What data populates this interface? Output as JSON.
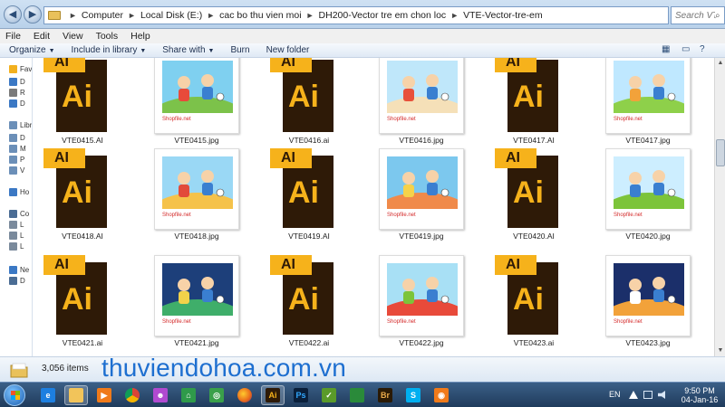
{
  "address": {
    "crumbs": [
      "Computer",
      "Local Disk (E:)",
      "cac bo thu vien moi",
      "DH200-Vector tre em chon loc",
      "VTE-Vector-tre-em"
    ]
  },
  "search": {
    "placeholder": "Search VTE..."
  },
  "menu": [
    "File",
    "Edit",
    "View",
    "Tools",
    "Help"
  ],
  "commands": {
    "organize": "Organize",
    "include": "Include in library",
    "share": "Share with",
    "burn": "Burn",
    "new_folder": "New folder"
  },
  "nav": [
    {
      "label": "Fav",
      "icon": "star-icon",
      "color": "#f2b01e"
    },
    {
      "label": "D",
      "icon": "desktop-icon",
      "color": "#3b78c4"
    },
    {
      "label": "R",
      "icon": "recent-icon",
      "color": "#7a7a7a"
    },
    {
      "label": "D",
      "icon": "downloads-icon",
      "color": "#3b78c4"
    },
    {
      "label": "Libr",
      "icon": "library-icon",
      "color": "#6b8fb8"
    },
    {
      "label": "D",
      "icon": "documents-icon",
      "color": "#6b8fb8"
    },
    {
      "label": "M",
      "icon": "music-icon",
      "color": "#6b8fb8"
    },
    {
      "label": "P",
      "icon": "pictures-icon",
      "color": "#6b8fb8"
    },
    {
      "label": "V",
      "icon": "videos-icon",
      "color": "#6b8fb8"
    },
    {
      "label": "Ho",
      "icon": "homegroup-icon",
      "color": "#3b78c4"
    },
    {
      "label": "Co",
      "icon": "computer-icon",
      "color": "#4a6c94"
    },
    {
      "label": "L",
      "icon": "drive-icon",
      "color": "#7a8a9c"
    },
    {
      "label": "L",
      "icon": "drive-icon",
      "color": "#7a8a9c"
    },
    {
      "label": "L",
      "icon": "drive-icon",
      "color": "#7a8a9c"
    },
    {
      "label": "Ne",
      "icon": "network-icon",
      "color": "#3b78c4"
    },
    {
      "label": "D",
      "icon": "network-pc-icon",
      "color": "#4a6c94"
    }
  ],
  "files": [
    {
      "name": "VTE0415.AI",
      "type": "ai"
    },
    {
      "name": "VTE0415.jpg",
      "type": "jpg",
      "palette": [
        "#7fd0f0",
        "#7cc24a",
        "#e84a3a"
      ]
    },
    {
      "name": "VTE0416.ai",
      "type": "ai"
    },
    {
      "name": "VTE0416.jpg",
      "type": "jpg",
      "palette": [
        "#bfe7fa",
        "#f5e0b8",
        "#e8503a"
      ]
    },
    {
      "name": "VTE0417.AI",
      "type": "ai"
    },
    {
      "name": "VTE0417.jpg",
      "type": "jpg",
      "palette": [
        "#bfe8ff",
        "#8ed04a",
        "#f2a23a"
      ]
    },
    {
      "name": "VTE0418.AI",
      "type": "ai"
    },
    {
      "name": "VTE0418.jpg",
      "type": "jpg",
      "palette": [
        "#9ad8f5",
        "#f5c24a",
        "#e24a3a"
      ]
    },
    {
      "name": "VTE0419.AI",
      "type": "ai"
    },
    {
      "name": "VTE0419.jpg",
      "type": "jpg",
      "palette": [
        "#7cc8ee",
        "#f08a4a",
        "#f5d24a"
      ]
    },
    {
      "name": "VTE0420.AI",
      "type": "ai"
    },
    {
      "name": "VTE0420.jpg",
      "type": "jpg",
      "palette": [
        "#cdeeff",
        "#7cc43a",
        "#3a7fd0"
      ]
    },
    {
      "name": "VTE0421.ai",
      "type": "ai"
    },
    {
      "name": "VTE0421.jpg",
      "type": "jpg",
      "palette": [
        "#1d3f7a",
        "#3fae6a",
        "#f2d24a"
      ]
    },
    {
      "name": "VTE0422.ai",
      "type": "ai"
    },
    {
      "name": "VTE0422.jpg",
      "type": "jpg",
      "palette": [
        "#a8e0f5",
        "#e84a3a",
        "#7cc43a"
      ]
    },
    {
      "name": "VTE0423.ai",
      "type": "ai"
    },
    {
      "name": "VTE0423.jpg",
      "type": "jpg",
      "palette": [
        "#1b2f6a",
        "#f2a23a",
        "#ffffff"
      ]
    }
  ],
  "ai_labels": {
    "tab": "AI",
    "big": "Ai"
  },
  "watermark": "Shopfile.net",
  "details": {
    "count": "3,056 items",
    "brand": "thuviendohoa.com.vn"
  },
  "taskbar": {
    "apps": [
      {
        "name": "ie",
        "glyph": "e",
        "bg": "#1d7fe0",
        "fg": "#ffffff"
      },
      {
        "name": "explorer",
        "glyph": "",
        "bg": "#f2c45a",
        "fg": "#7a5a10",
        "active": true
      },
      {
        "name": "media",
        "glyph": "▶",
        "bg": "#f07a1a",
        "fg": "#ffffff"
      },
      {
        "name": "chrome",
        "glyph": "",
        "bg": "#ffffff",
        "fg": "#333333"
      },
      {
        "name": "app5",
        "glyph": "☻",
        "bg": "#b04ad0",
        "fg": "#ffffff"
      },
      {
        "name": "app6",
        "glyph": "⌂",
        "bg": "#2f9a4a",
        "fg": "#ffffff"
      },
      {
        "name": "app7",
        "glyph": "◎",
        "bg": "#3aa04a",
        "fg": "#ffffff"
      },
      {
        "name": "firefox",
        "glyph": "",
        "bg": "#e8661a",
        "fg": "#ffffff"
      },
      {
        "name": "illustrator",
        "glyph": "Ai",
        "bg": "#2e1a07",
        "fg": "#f6b21b",
        "active": true
      },
      {
        "name": "photoshop",
        "glyph": "Ps",
        "bg": "#0a1f3a",
        "fg": "#31a8ff"
      },
      {
        "name": "app11",
        "glyph": "✓",
        "bg": "#5a9a2a",
        "fg": "#ffffff"
      },
      {
        "name": "app12",
        "glyph": "",
        "bg": "#2a8a3a",
        "fg": "#ffffff"
      },
      {
        "name": "bridge",
        "glyph": "Br",
        "bg": "#2b1a05",
        "fg": "#e8a94a"
      },
      {
        "name": "skype",
        "glyph": "S",
        "bg": "#00aff0",
        "fg": "#ffffff"
      },
      {
        "name": "app15",
        "glyph": "◉",
        "bg": "#f07a1a",
        "fg": "#ffffff"
      }
    ],
    "lang": "EN",
    "time": "9:50 PM",
    "date": "04-Jan-16"
  }
}
